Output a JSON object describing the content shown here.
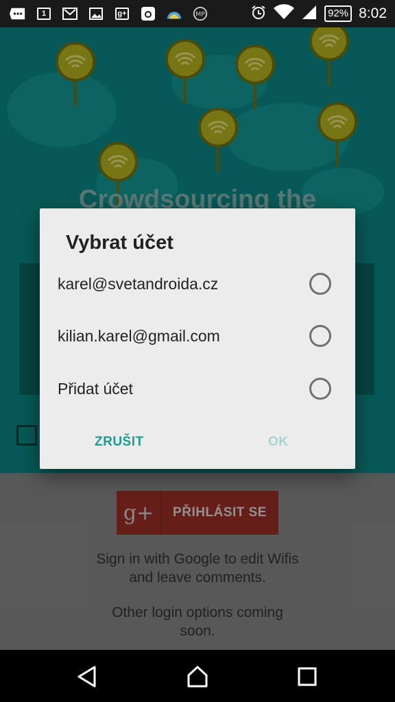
{
  "status_bar": {
    "icons": [
      "overflow-icon",
      "calendar-icon",
      "gmail-icon",
      "gallery-icon",
      "google-plus-icon",
      "instagram-icon",
      "weather-icon",
      "app-icon",
      "alarm-icon",
      "wifi-icon",
      "signal-icon"
    ],
    "calendar_day": "1",
    "gplus_mark": "g+",
    "battery": "92%",
    "time": "8:02"
  },
  "app": {
    "headline": "Crowdsourcing the",
    "google_button_icon": "g+",
    "google_button_label": "PŘIHLÁSIT SE",
    "signin_line1": "Sign in with Google to edit Wifis",
    "signin_line2": "and leave comments.",
    "other_line1": "Other login options coming",
    "other_line2": "soon."
  },
  "dialog": {
    "title": "Vybrat účet",
    "options": [
      {
        "label": "karel@svetandroida.cz",
        "selected": false
      },
      {
        "label": "kilian.karel@gmail.com",
        "selected": false
      },
      {
        "label": "Přidat účet",
        "selected": false
      }
    ],
    "cancel_label": "ZRUŠIT",
    "ok_label": "OK"
  },
  "nav": {
    "buttons": [
      "back-icon",
      "home-icon",
      "recents-icon"
    ]
  },
  "colors": {
    "teal": "#0a7c79",
    "accent": "#1c9b8f",
    "pin": "#a7a31c",
    "google_red": "#8e2a22"
  }
}
